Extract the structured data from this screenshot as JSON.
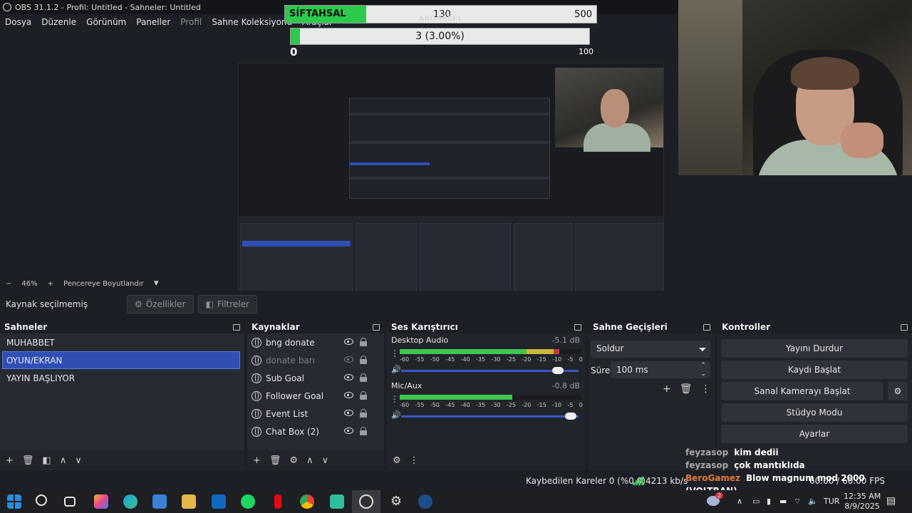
{
  "window": {
    "title": "OBS 31.1.2 - Profil: Untitled - Sahneler: Untitled"
  },
  "menu": [
    {
      "label": "Dosya",
      "dim": false
    },
    {
      "label": "Düzenle",
      "dim": false
    },
    {
      "label": "Görünüm",
      "dim": false
    },
    {
      "label": "Paneller",
      "dim": false
    },
    {
      "label": "Profil",
      "dim": true
    },
    {
      "label": "Sahne Koleksiyonu",
      "dim": false
    },
    {
      "label": "Araçlar",
      "dim": false
    }
  ],
  "goal": {
    "label": "SİFTAHSAL",
    "current": "130",
    "max": "500",
    "progress": 0.26,
    "subtitle": "ABONESEL"
  },
  "goal2": {
    "current": "3 (3.00%)",
    "progress": 0.03,
    "min": "0",
    "max": "100"
  },
  "zoom": {
    "minus": "−",
    "percent": "46%",
    "plus": "+",
    "fit": "Pencereye Boyutlandır"
  },
  "source_bar": {
    "status": "Kaynak seçilmemiş",
    "properties": "Özellikler",
    "filters": "Filtreler"
  },
  "scenes": {
    "title": "Sahneler",
    "items": [
      {
        "label": "MUHABBET",
        "selected": false
      },
      {
        "label": "OYUN/EKRAN",
        "selected": true
      },
      {
        "label": "YAYIN BAŞLIYOR",
        "selected": false
      }
    ]
  },
  "sources": {
    "title": "Kaynaklar",
    "items": [
      {
        "label": "bng donate",
        "visible": true
      },
      {
        "label": "donate barı",
        "visible": false
      },
      {
        "label": "Sub Goal",
        "visible": true
      },
      {
        "label": "Follower Goal",
        "visible": true
      },
      {
        "label": "Event List",
        "visible": true
      },
      {
        "label": "Chat Box (2)",
        "visible": true
      }
    ]
  },
  "mixer": {
    "title": "Ses Karıştırıcı",
    "ticks": [
      "-60",
      "-55",
      "-50",
      "-45",
      "-40",
      "-35",
      "-30",
      "-25",
      "-20",
      "-15",
      "-10",
      "-5",
      "0"
    ],
    "channels": [
      {
        "name": "Desktop Audio",
        "db": "-5.1 dB",
        "level": 0.88,
        "volume": 0.9
      },
      {
        "name": "Mic/Aux",
        "db": "-0.8 dB",
        "level": 0.62,
        "volume": 0.97
      }
    ]
  },
  "transitions": {
    "title": "Sahne Geçişleri",
    "selected": "Soldur",
    "duration_label": "Süre",
    "duration": "100 ms"
  },
  "controls": {
    "title": "Kontroller",
    "buttons": [
      "Yayını Durdur",
      "Kaydı Başlat",
      "Sanal Kamerayı Başlat",
      "Stüdyo Modu",
      "Ayarlar"
    ]
  },
  "chat": [
    {
      "user": "feyzasop",
      "msg": "kim dedii"
    },
    {
      "user": "feyzasop",
      "msg": "çok mantıklıda"
    },
    {
      "user": "BeroGamez",
      "msg": "Blow magnum mod 2000 (VOLTRAN)"
    }
  ],
  "status": {
    "dropped": "Kaybedilen Kareler 0 (%0.0)",
    "kbps": "4213 kb/s",
    "fps": "60.00 / 60.00 FPS"
  },
  "taskbar": {
    "lang": "TUR",
    "time": "12:35 AM",
    "date": "8/9/2025",
    "weather_badge": "2"
  },
  "colors": {
    "accent": "#2f4fb5",
    "goal_fill": "#2cc94a",
    "meter_green": "#3ec64f",
    "meter_yellow": "#c9b83a",
    "meter_red": "#c83a3a"
  }
}
